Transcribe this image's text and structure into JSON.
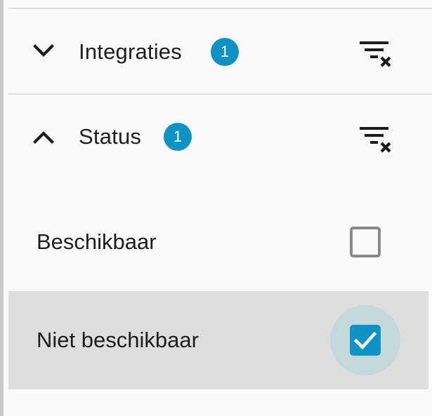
{
  "colors": {
    "accent": "#0f93c6",
    "selected_row": "#dedede",
    "background": "#fafafa"
  },
  "sections": [
    {
      "title": "Integraties",
      "count": "1",
      "expanded": false,
      "chevron_icon": "chevron-down-icon",
      "clear_icon": "filter-clear-icon"
    },
    {
      "title": "Status",
      "count": "1",
      "expanded": true,
      "chevron_icon": "chevron-up-icon",
      "clear_icon": "filter-clear-icon",
      "options": [
        {
          "label": "Beschikbaar",
          "checked": false
        },
        {
          "label": "Niet beschikbaar",
          "checked": true
        }
      ]
    }
  ]
}
